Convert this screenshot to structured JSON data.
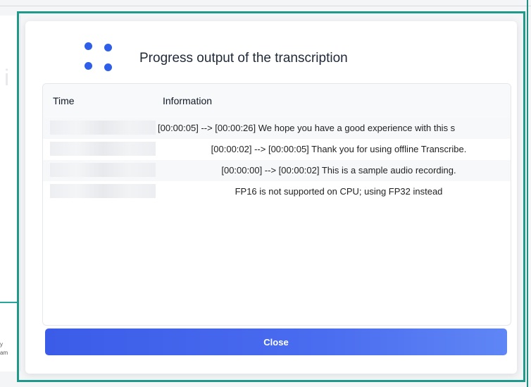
{
  "dialog": {
    "title": "Progress output of the transcription",
    "icon": "four-dots-icon",
    "accent_color": "#2f5fe8",
    "frame_color": "#1f9a8a"
  },
  "table": {
    "headers": {
      "time": "Time",
      "information": "Information"
    },
    "rows": [
      {
        "information": "[00:00:05] --> [00:00:26]  We hope you have a good experience with this s"
      },
      {
        "information": "[00:00:02] --> [00:00:05]  Thank you for using offline Transcribe."
      },
      {
        "information": "[00:00:00] --> [00:00:02]  This is a sample audio recording."
      },
      {
        "information": "FP16 is not supported on CPU; using FP32 instead"
      }
    ]
  },
  "buttons": {
    "close_label": "Close",
    "close_color": "#3b5ce8"
  },
  "background": {
    "ghost_letter": "i",
    "side_text_1": "y",
    "side_text_2": "am"
  }
}
